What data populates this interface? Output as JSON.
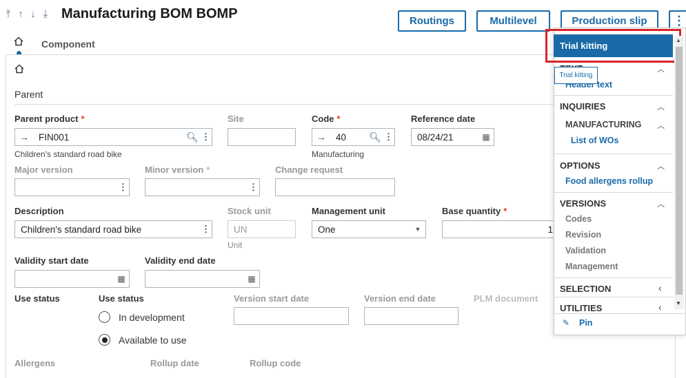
{
  "header": {
    "nav_arrows": [
      "⤒",
      "↑",
      "↓",
      "⤓"
    ],
    "title": "Manufacturing BOM BOMP",
    "buttons": {
      "routings": "Routings",
      "multilevel": "Multilevel",
      "production_slip": "Production slip",
      "more": "⋮"
    }
  },
  "tabs": {
    "component": "Component"
  },
  "section": {
    "parent": "Parent"
  },
  "fields": {
    "parent_product": {
      "label": "Parent product",
      "value": "FIN001",
      "sub": "Children's standard road bike"
    },
    "site": {
      "label": "Site",
      "value": ""
    },
    "code": {
      "label": "Code",
      "value": "40",
      "sub": "Manufacturing"
    },
    "reference_date": {
      "label": "Reference date",
      "value": "08/24/21"
    },
    "major_version": {
      "label": "Major version",
      "value": ""
    },
    "minor_version": {
      "label": "Minor version",
      "value": ""
    },
    "change_request": {
      "label": "Change request",
      "value": ""
    },
    "description": {
      "label": "Description",
      "value": "Children's standard road bike"
    },
    "stock_unit": {
      "label": "Stock unit",
      "value": "UN",
      "sub": "Unit"
    },
    "management_unit": {
      "label": "Management unit",
      "value": "One"
    },
    "base_quantity": {
      "label": "Base quantity",
      "value": "1"
    },
    "validity_start": {
      "label": "Validity start date",
      "value": ""
    },
    "validity_end": {
      "label": "Validity end date",
      "value": ""
    },
    "use_status_label": "Use status",
    "use_status_group": "Use status",
    "use_status_options": [
      "In development",
      "Available to use"
    ],
    "use_status_selected": "Available to use",
    "version_start": {
      "label": "Version start date",
      "value": ""
    },
    "version_end": {
      "label": "Version end date",
      "value": ""
    },
    "plm_document": {
      "label": "PLM document"
    },
    "allergens": {
      "label": "Allergens"
    },
    "rollup_date": {
      "label": "Rollup date"
    },
    "rollup_code": {
      "label": "Rollup code"
    },
    "required_marker": "*"
  },
  "menu": {
    "highlighted": "Trial kitting",
    "tooltip": "Trial kitting",
    "text_header": "TEXT",
    "text_item": "Header text",
    "inquiries": "INQUIRIES",
    "manufacturing": "MANUFACTURING",
    "list_of_wos": "List of WOs",
    "options": "OPTIONS",
    "food_allergens": "Food allergens rollup",
    "versions": "VERSIONS",
    "version_items": [
      "Codes",
      "Revision",
      "Validation",
      "Management"
    ],
    "selection": "SELECTION",
    "utilities": "UTILITIES",
    "pin": "Pin"
  },
  "colors": {
    "accent": "#1a6aa8",
    "required": "#e0431b",
    "highlight_box": "#d9232a"
  }
}
